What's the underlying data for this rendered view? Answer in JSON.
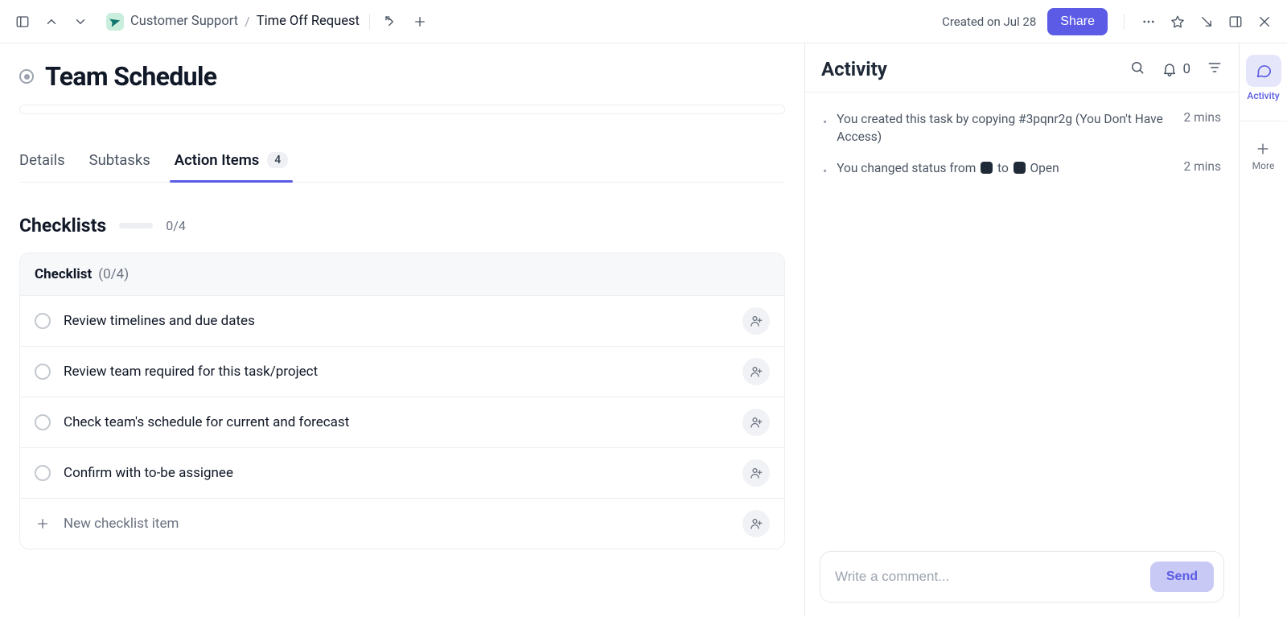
{
  "topbar": {
    "breadcrumb_space": "Customer Support",
    "breadcrumb_current": "Time Off Request",
    "created_on": "Created on Jul 28",
    "share_label": "Share"
  },
  "page": {
    "title": "Team Schedule"
  },
  "tabs": {
    "details": "Details",
    "subtasks": "Subtasks",
    "action_items": "Action Items",
    "action_items_badge": "4"
  },
  "checklists": {
    "section_title": "Checklists",
    "overall_count": "0/4",
    "group_name": "Checklist",
    "group_count": "(0/4)",
    "items": [
      {
        "label": "Review timelines and due dates"
      },
      {
        "label": "Review team required for this task/project"
      },
      {
        "label": "Check team's schedule for current and forecast"
      },
      {
        "label": "Confirm with to-be assignee"
      }
    ],
    "new_item_placeholder": "New checklist item"
  },
  "activity": {
    "title": "Activity",
    "notif_count": "0",
    "feed": [
      {
        "text_before": "You created this task by copying #3pqnr2g (You Don't Have Access)",
        "time": "2 mins",
        "kind": "plain"
      },
      {
        "text_before": "You changed status from ",
        "text_mid": " to ",
        "text_after": " Open",
        "time": "2 mins",
        "kind": "status"
      }
    ],
    "comment_placeholder": "Write a comment...",
    "send_label": "Send"
  },
  "rail": {
    "activity_label": "Activity",
    "more_label": "More"
  }
}
